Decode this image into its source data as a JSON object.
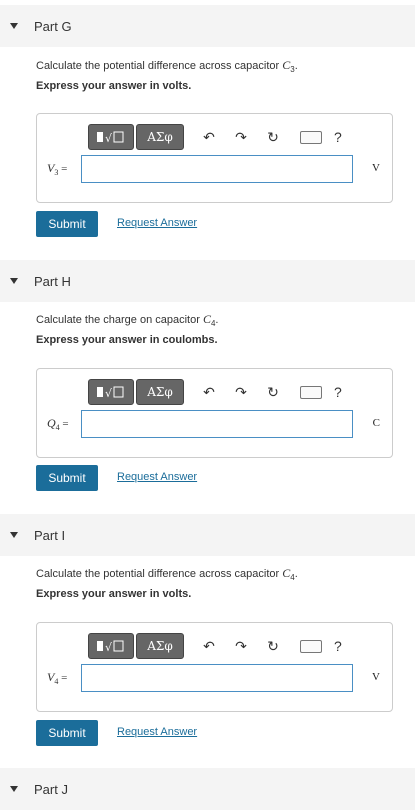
{
  "parts": [
    {
      "title": "Part G",
      "prompt": "Calculate the potential difference across capacitor ",
      "cap": "C",
      "sub": "3",
      "instr": "Express your answer in volts.",
      "var": "V",
      "varsub": "3",
      "unit": "V"
    },
    {
      "title": "Part H",
      "prompt": "Calculate the charge on capacitor ",
      "cap": "C",
      "sub": "4",
      "instr": "Express your answer in coulombs.",
      "var": "Q",
      "varsub": "4",
      "unit": "C"
    },
    {
      "title": "Part I",
      "prompt": "Calculate the potential difference across capacitor ",
      "cap": "C",
      "sub": "4",
      "instr": "Express your answer in volts.",
      "var": "V",
      "varsub": "4",
      "unit": "V"
    },
    {
      "title": "Part J"
    }
  ],
  "toolbar": {
    "templates_icon": "fraction-sqrt-icon",
    "greek_label": "ΑΣφ",
    "undo_icon": "undo-icon",
    "redo_icon": "redo-icon",
    "reset_icon": "reset-icon",
    "keyboard_icon": "keyboard-icon",
    "help_label": "?"
  },
  "submit_label": "Submit",
  "request_label": "Request Answer"
}
